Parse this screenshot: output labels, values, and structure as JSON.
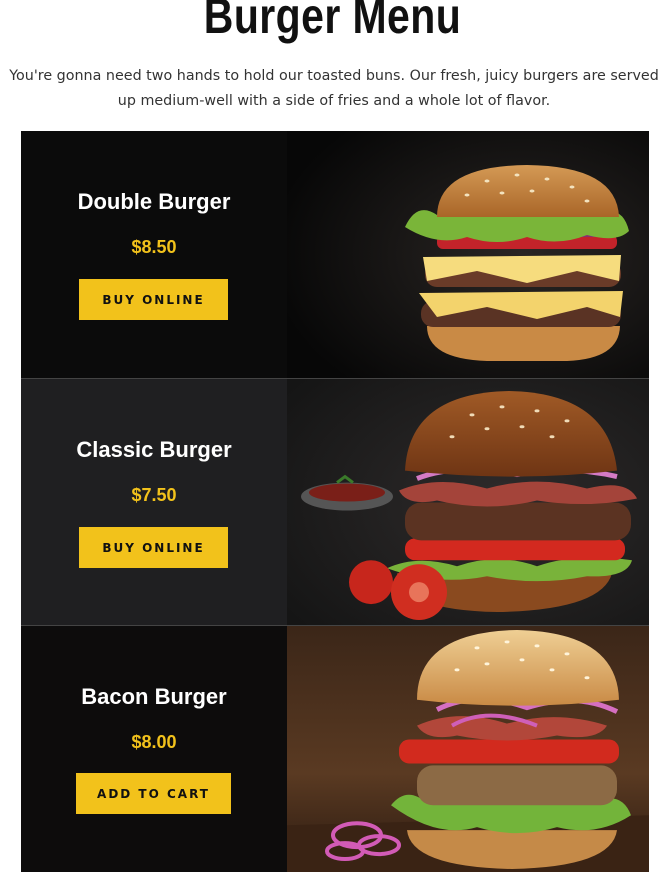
{
  "header": {
    "title": "Burger Menu",
    "intro": "You're gonna need two hands to hold our toasted buns. Our fresh, juicy burgers are served up medium-well with a side of fries and a whole lot of flavor."
  },
  "menu": {
    "items": [
      {
        "name": "Double Burger",
        "price": "$8.50",
        "button": "BUY ONLINE"
      },
      {
        "name": "Classic Burger",
        "price": "$7.50",
        "button": "BUY ONLINE"
      },
      {
        "name": "Bacon Burger",
        "price": "$8.00",
        "button": "ADD TO CART"
      }
    ]
  },
  "colors": {
    "accent": "#f2c21b",
    "panel_dark": "#0b0b0b",
    "panel_gray": "#1f1f21"
  }
}
